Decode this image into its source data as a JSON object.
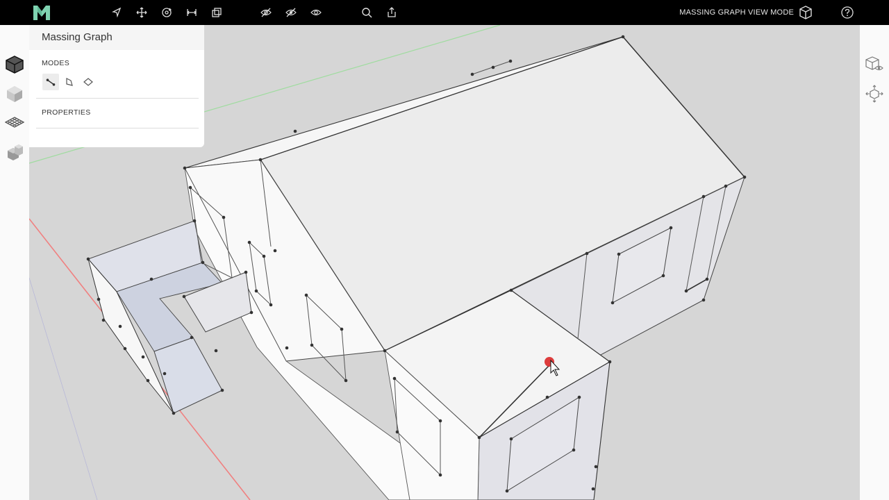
{
  "topbar": {
    "tools": [
      {
        "name": "select-arrow-icon"
      },
      {
        "name": "move-icon"
      },
      {
        "name": "orbit-icon"
      },
      {
        "name": "measure-icon"
      },
      {
        "name": "section-box-icon"
      },
      {
        "name": "hide-icon"
      },
      {
        "name": "isolate-icon"
      },
      {
        "name": "show-all-icon"
      },
      {
        "name": "search-icon"
      },
      {
        "name": "share-icon"
      }
    ],
    "mode_label": "MASSING GRAPH VIEW MODE",
    "mode_icon": "cube-outline-icon",
    "help_icon": "help-icon"
  },
  "left_rail": {
    "items": [
      {
        "name": "massing-graph-icon",
        "active": true
      },
      {
        "name": "solid-cube-icon",
        "active": false
      },
      {
        "name": "grid-plane-icon",
        "active": false
      },
      {
        "name": "building-blocks-icon",
        "active": false
      }
    ]
  },
  "right_rail": {
    "items": [
      {
        "name": "view-cube-visibility-icon"
      },
      {
        "name": "fit-view-icon"
      }
    ]
  },
  "panel": {
    "title": "Massing Graph",
    "modes_label": "MODES",
    "modes": [
      {
        "name": "edge-mode-icon",
        "active": true
      },
      {
        "name": "face-mode-icon",
        "active": false
      },
      {
        "name": "plane-mode-icon",
        "active": false
      }
    ],
    "properties_label": "PROPERTIES"
  },
  "colors": {
    "topbar": "#000000",
    "logo": "#7fd3b1",
    "axis_red": "#f08080",
    "axis_green": "#9fdc9f",
    "cursor_marker": "#d81b1b"
  }
}
